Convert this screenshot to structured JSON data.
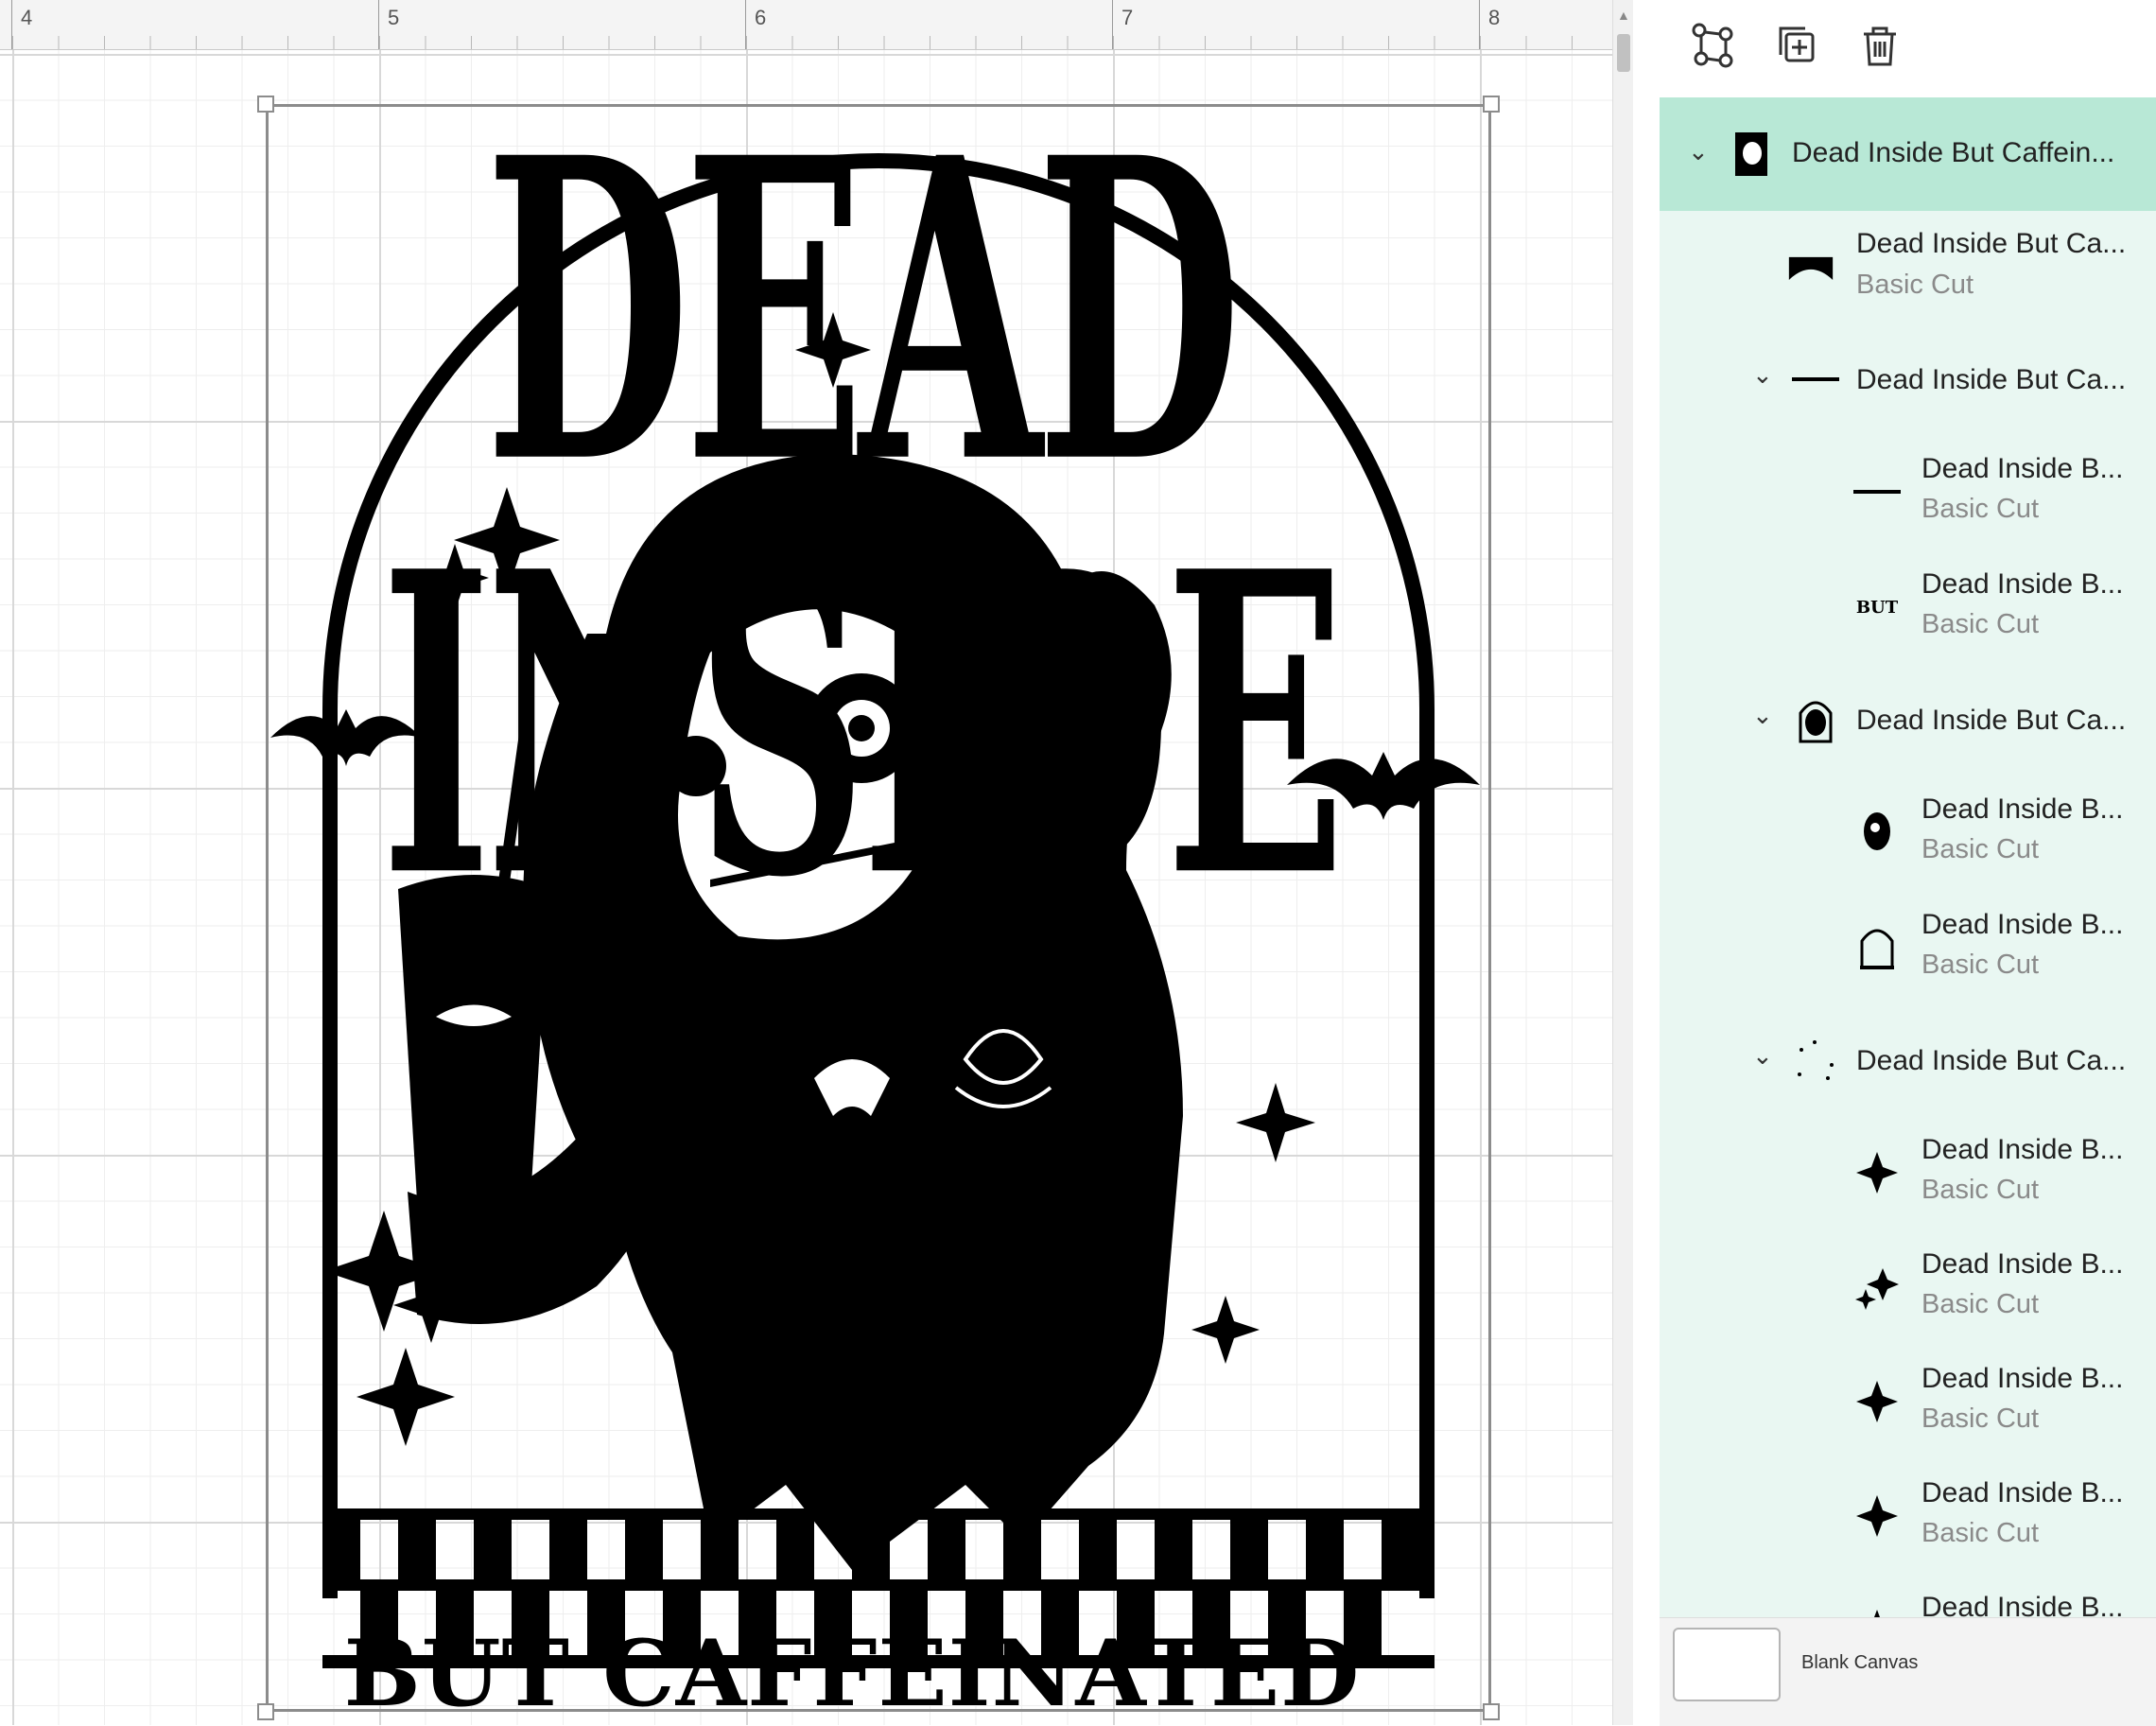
{
  "ruler": {
    "numbers": [
      "4",
      "5",
      "6",
      "7",
      "8"
    ]
  },
  "design": {
    "title_top": "DEAD INSIDE",
    "title_bottom": "BUT CAFFEINATED"
  },
  "toolbar": {
    "icons": [
      "ungroup-icon",
      "duplicate-icon",
      "trash-icon"
    ]
  },
  "layers": [
    {
      "name": "Dead Inside But Caffein...",
      "sub": "",
      "thumb": "full-design-thumb",
      "selected": true,
      "chevron": true
    },
    {
      "name": "Dead Inside But Ca...",
      "sub": "Basic Cut",
      "thumb": "arch-text-thumb"
    },
    {
      "name": "Dead Inside But Ca...",
      "sub": "",
      "thumb": "line-thumb",
      "chevron": true
    },
    {
      "name": "Dead Inside B...",
      "sub": "Basic Cut",
      "thumb": "line-thumb"
    },
    {
      "name": "Dead Inside B...",
      "sub": "Basic Cut",
      "thumb": "but-text-thumb"
    },
    {
      "name": "Dead Inside But Ca...",
      "sub": "",
      "thumb": "girl-frame-thumb",
      "chevron": true
    },
    {
      "name": "Dead Inside B...",
      "sub": "Basic Cut",
      "thumb": "girl-thumb"
    },
    {
      "name": "Dead Inside B...",
      "sub": "Basic Cut",
      "thumb": "arch-frame-thumb"
    },
    {
      "name": "Dead Inside But Ca...",
      "sub": "",
      "thumb": "sparkles-thumb",
      "chevron": true
    },
    {
      "name": "Dead Inside B...",
      "sub": "Basic Cut",
      "thumb": "star-thumb"
    },
    {
      "name": "Dead Inside B...",
      "sub": "Basic Cut",
      "thumb": "double-star-thumb"
    },
    {
      "name": "Dead Inside B...",
      "sub": "Basic Cut",
      "thumb": "star-thumb"
    },
    {
      "name": "Dead Inside B...",
      "sub": "Basic Cut",
      "thumb": "star-thumb"
    },
    {
      "name": "Dead Inside B...",
      "sub": "",
      "thumb": "star-thumb"
    }
  ],
  "bottom": {
    "canvas_label": "Blank Canvas"
  },
  "colors": {
    "selected_row": "#b8e8d6",
    "panel_bg": "#e9f7f2"
  }
}
